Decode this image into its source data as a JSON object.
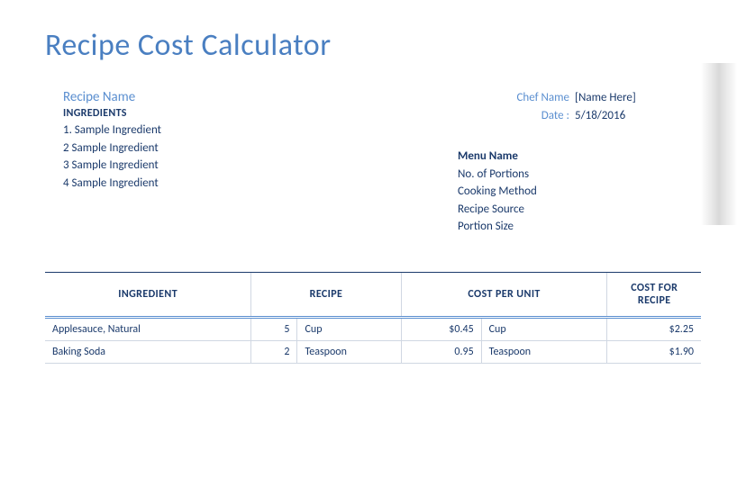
{
  "title": "Recipe Cost Calculator",
  "recipeNameLabel": "Recipe Name",
  "ingredientsLabel": "INGREDIENTS",
  "ingredients": [
    "1. Sample Ingredient",
    "2 Sample Ingredient",
    "3 Sample Ingredient",
    "4 Sample Ingredient"
  ],
  "meta": {
    "chefLabel": "Chef Name",
    "chefValue": "[Name Here]",
    "dateLabel": "Date :",
    "dateValue": "5/18/2016"
  },
  "menu": {
    "name": "Menu Name",
    "portions": "No. of Portions",
    "method": "Cooking Method",
    "source": "Recipe Source",
    "size": "Portion Size"
  },
  "tableHeaders": {
    "ingredient": "INGREDIENT",
    "recipe": "RECIPE",
    "costPerUnit": "COST PER UNIT",
    "costForRecipe": "COST FOR RECIPE"
  },
  "rows": [
    {
      "ingredient": "Applesauce, Natural",
      "qty": "5",
      "unit": "Cup",
      "cpu": "$0.45",
      "cpuUnit": "Cup",
      "cfr": "$2.25"
    },
    {
      "ingredient": "Baking Soda",
      "qty": "2",
      "unit": "Teaspoon",
      "cpu": "0.95",
      "cpuUnit": "Teaspoon",
      "cfr": "$1.90"
    }
  ]
}
